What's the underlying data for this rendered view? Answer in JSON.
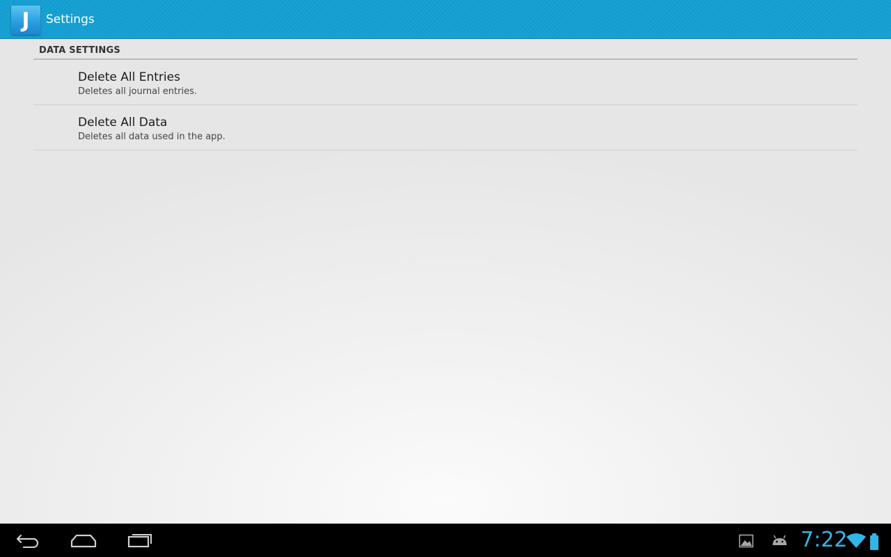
{
  "action_bar": {
    "icon_letter": "J",
    "title": "Settings"
  },
  "settings": {
    "section_header": "DATA SETTINGS",
    "items": [
      {
        "title": "Delete All Entries",
        "summary": "Deletes all journal entries."
      },
      {
        "title": "Delete All Data",
        "summary": "Deletes all data used in the app."
      }
    ]
  },
  "system_bar": {
    "clock": "7:22",
    "icons": [
      "back-icon",
      "home-icon",
      "recent-apps-icon",
      "gallery-notification-icon",
      "android-notification-icon",
      "wifi-icon",
      "battery-icon"
    ],
    "accent_color": "#33b5e5"
  },
  "colors": {
    "action_bar": "#1aa3d6",
    "nav_bar": "#000000"
  }
}
